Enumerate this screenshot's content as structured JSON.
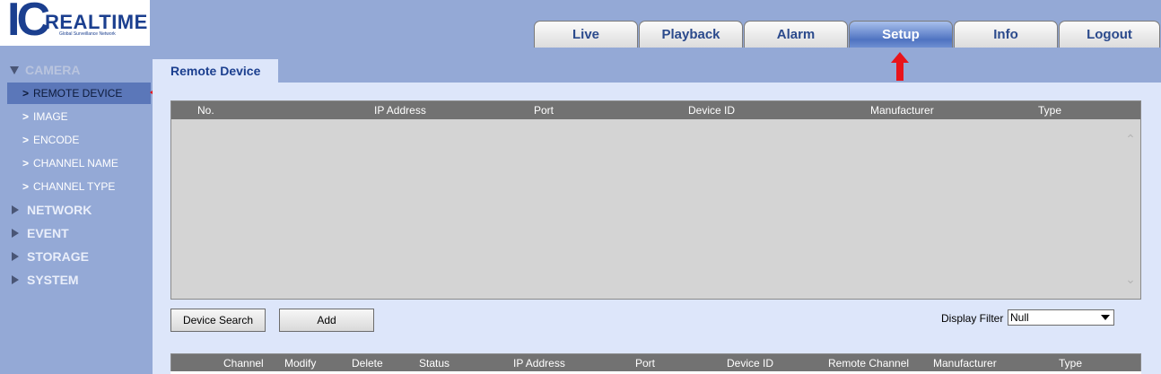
{
  "logo": {
    "mark": "IC",
    "name": "REALTIME",
    "tagline": "Global Surveillance Network"
  },
  "nav": {
    "tabs": [
      "Live",
      "Playback",
      "Alarm",
      "Setup",
      "Info",
      "Logout"
    ],
    "active": "Setup"
  },
  "sidebar": {
    "camera": "CAMERA",
    "camera_items": [
      "REMOTE DEVICE",
      "IMAGE",
      "ENCODE",
      "CHANNEL NAME",
      "CHANNEL TYPE"
    ],
    "active_item": "REMOTE DEVICE",
    "groups": [
      "NETWORK",
      "EVENT",
      "STORAGE",
      "SYSTEM"
    ]
  },
  "page": {
    "tab_title": "Remote Device"
  },
  "device_grid": {
    "columns": [
      "No.",
      "IP Address",
      "Port",
      "Device ID",
      "Manufacturer",
      "Type"
    ],
    "rows": []
  },
  "actions": {
    "device_search": "Device Search",
    "add": "Add"
  },
  "filter": {
    "label": "Display Filter",
    "value": "Null"
  },
  "added_grid": {
    "columns": [
      "Channel",
      "Modify",
      "Delete",
      "Status",
      "IP Address",
      "Port",
      "Device ID",
      "Remote Channel",
      "Manufacturer",
      "Type"
    ]
  },
  "colors": {
    "background": "#94a9d6",
    "content": "#dde6fa",
    "brand": "#1b3f8f",
    "grid_header": "#727272",
    "arrow": "#e8141b"
  }
}
